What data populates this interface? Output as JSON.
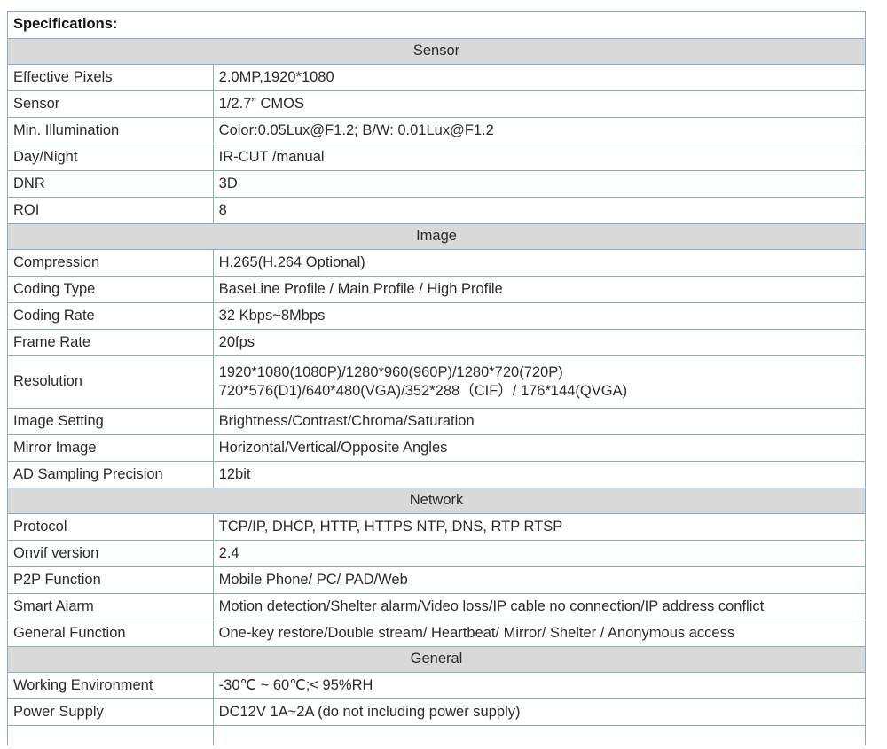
{
  "document": {
    "title": "Specifications:",
    "accent_border_color": "#8ea9c1",
    "section_header_bg": "#d9d9d9"
  },
  "table": {
    "sections": [
      {
        "header": "Sensor",
        "rows": [
          {
            "label": "Effective Pixels",
            "value": "2.0MP,1920*1080"
          },
          {
            "label": "Sensor",
            "value": "1/2.7” CMOS"
          },
          {
            "label": "Min. Illumination",
            "value": "Color:0.05Lux@F1.2; B/W: 0.01Lux@F1.2"
          },
          {
            "label": "Day/Night",
            "value": "IR-CUT /manual"
          },
          {
            "label": "DNR",
            "value": "3D"
          },
          {
            "label": "ROI",
            "value": "8"
          }
        ]
      },
      {
        "header": "Image",
        "rows": [
          {
            "label": "Compression",
            "value": "H.265(H.264 Optional)"
          },
          {
            "label": "Coding Type",
            "value": "BaseLine Profile / Main Profile / High Profile"
          },
          {
            "label": "Coding Rate",
            "value": "32 Kbps~8Mbps"
          },
          {
            "label": "Frame Rate",
            "value": "20fps"
          },
          {
            "label": "Resolution",
            "value_line1": "1920*1080(1080P)/1280*960(960P)/1280*720(720P)",
            "value_line2": "720*576(D1)/640*480(VGA)/352*288（CIF）/ 176*144(QVGA)",
            "tall": true
          },
          {
            "label": "Image Setting",
            "value": "Brightness/Contrast/Chroma/Saturation"
          },
          {
            "label": "Mirror Image",
            "value": "Horizontal/Vertical/Opposite Angles"
          },
          {
            "label": "AD Sampling Precision",
            "value": "12bit"
          }
        ]
      },
      {
        "header": "Network",
        "rows": [
          {
            "label": "Protocol",
            "value": "TCP/IP, DHCP, HTTP, HTTPS NTP, DNS, RTP RTSP"
          },
          {
            "label": "Onvif version",
            "value": "2.4"
          },
          {
            "label": "P2P Function",
            "value": "Mobile Phone/ PC/ PAD/Web"
          },
          {
            "label": "Smart Alarm",
            "value": "Motion detection/Shelter alarm/Video loss/IP cable no connection/IP address conflict"
          },
          {
            "label": "General Function",
            "value": "One-key restore/Double stream/ Heartbeat/ Mirror/ Shelter / Anonymous access"
          }
        ]
      },
      {
        "header": "General",
        "rows": [
          {
            "label": "Working Environment",
            "value": "-30℃ ~ 60℃;< 95%RH"
          },
          {
            "label": "Power Supply",
            "value": "DC12V 1A~2A (do not including power supply)"
          },
          {
            "label": "",
            "value": "",
            "partial": true
          }
        ]
      }
    ]
  }
}
